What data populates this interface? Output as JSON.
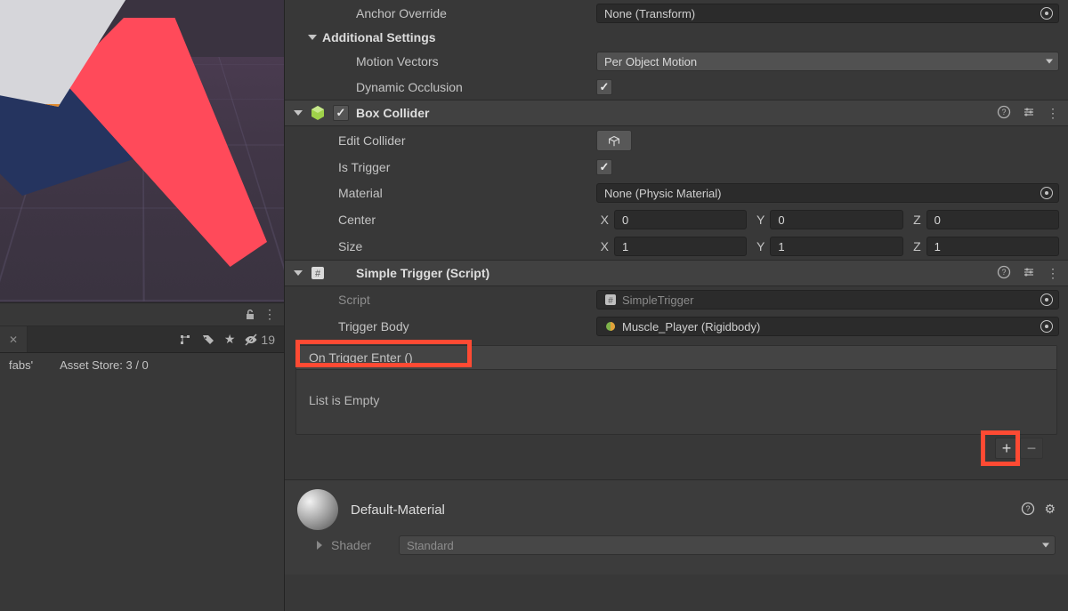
{
  "renderer": {
    "anchor_override_label": "Anchor Override",
    "anchor_override_value": "None (Transform)",
    "additional_settings_label": "Additional Settings",
    "motion_vectors_label": "Motion Vectors",
    "motion_vectors_value": "Per Object Motion",
    "dynamic_occlusion_label": "Dynamic Occlusion",
    "dynamic_occlusion_checked": true
  },
  "box_collider": {
    "title": "Box Collider",
    "enabled": true,
    "edit_collider_label": "Edit Collider",
    "is_trigger_label": "Is Trigger",
    "is_trigger_checked": true,
    "material_label": "Material",
    "material_value": "None (Physic Material)",
    "center_label": "Center",
    "center": {
      "x": "0",
      "y": "0",
      "z": "0"
    },
    "size_label": "Size",
    "size": {
      "x": "1",
      "y": "1",
      "z": "1"
    }
  },
  "simple_trigger": {
    "title": "Simple Trigger (Script)",
    "script_label": "Script",
    "script_value": "SimpleTrigger",
    "trigger_body_label": "Trigger Body",
    "trigger_body_value": "Muscle_Player (Rigidbody)",
    "event_name": "On Trigger Enter ()",
    "event_empty": "List is Empty"
  },
  "material": {
    "name": "Default-Material",
    "shader_label": "Shader",
    "shader_value": "Standard"
  },
  "project_panel": {
    "crumb_left": "fabs'",
    "crumb_right": "Asset Store: 3 / 0",
    "hidden_count": "19"
  },
  "glyph": {
    "plus": "+",
    "minus": "−",
    "vdots": "⋮",
    "help": "?",
    "gear": "⚙",
    "star": "★",
    "tag": "🏷",
    "eye_off": "⦸",
    "lock_open": "⊔",
    "x_label": "X",
    "y_label": "Y",
    "z_label": "Z",
    "hash": "#"
  }
}
